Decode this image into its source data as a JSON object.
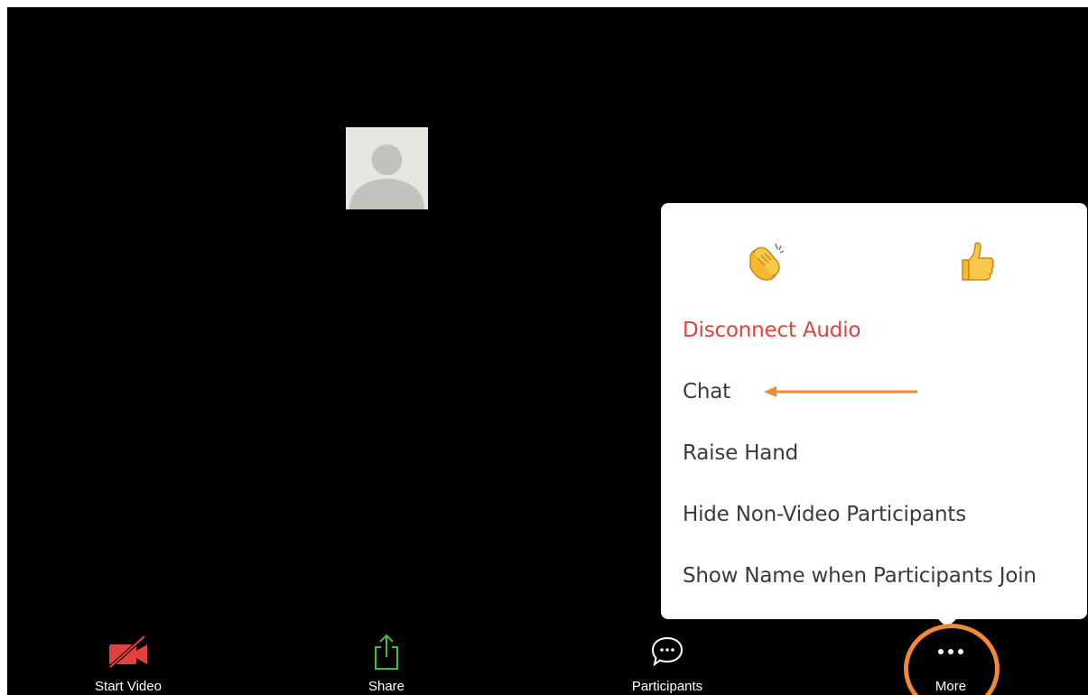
{
  "menu": {
    "reactions": [
      {
        "icon": "clapping-hands-icon"
      },
      {
        "icon": "thumbs-up-icon"
      }
    ],
    "items": [
      {
        "label": "Disconnect Audio",
        "color": "#e0423d"
      },
      {
        "label": "Chat"
      },
      {
        "label": "Raise Hand"
      },
      {
        "label": "Hide Non-Video Participants"
      },
      {
        "label": "Show Name when Participants Join"
      }
    ]
  },
  "toolbar": {
    "items": [
      {
        "label": "Start Video",
        "icon": "video-off-icon",
        "color": "#e0423d"
      },
      {
        "label": "Share",
        "icon": "share-icon",
        "color": "#3fbf3f"
      },
      {
        "label": "Participants",
        "icon": "participants-chat-bubble-icon"
      },
      {
        "label": "More",
        "icon": "more-dots-icon"
      }
    ]
  },
  "annotations": {
    "arrow_color": "#f08a34",
    "circle_color": "#f08a34"
  }
}
